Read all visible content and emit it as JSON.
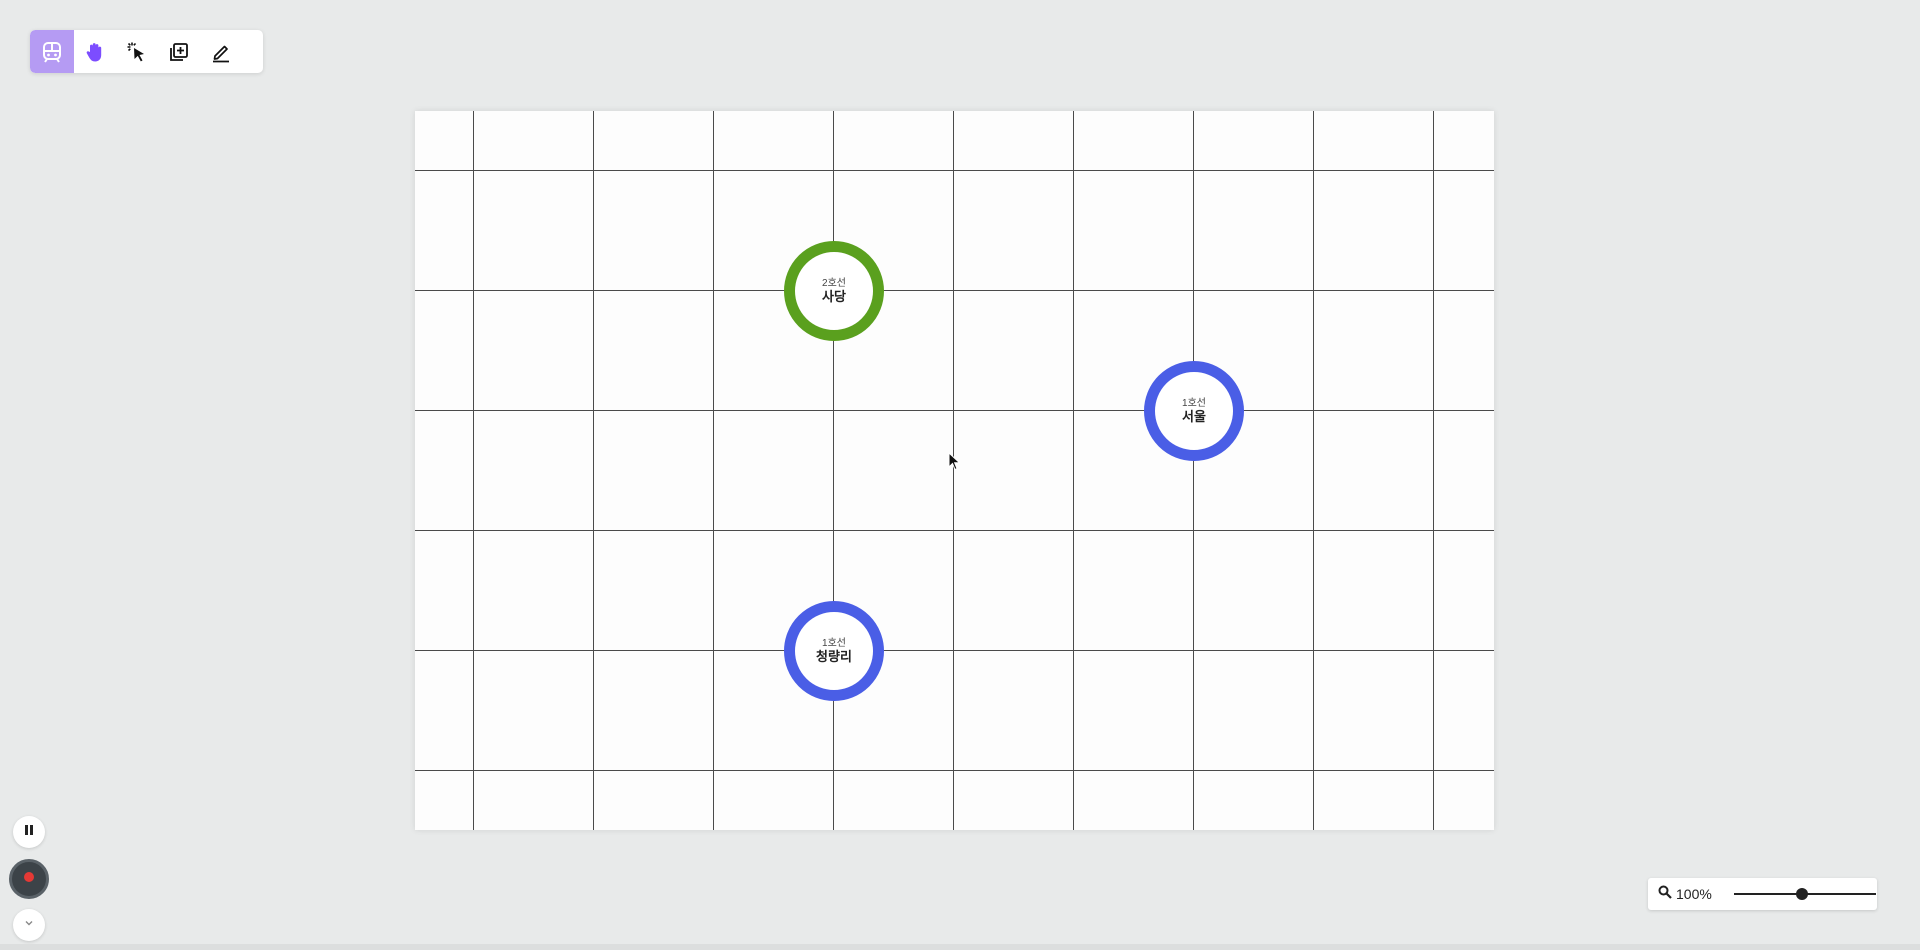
{
  "toolbar": {
    "tools": [
      {
        "icon": "train-icon",
        "active": true
      },
      {
        "icon": "hand-icon"
      },
      {
        "icon": "select-cursor-icon"
      },
      {
        "icon": "add-layer-icon"
      },
      {
        "icon": "pen-icon"
      }
    ],
    "active_color": "#b59bf3",
    "hand_color": "#7c4dff"
  },
  "stations": [
    {
      "line": "2호선",
      "name": "사당",
      "color": "#5aa01e"
    },
    {
      "line": "1호선",
      "name": "서울",
      "color": "#4a5ee6"
    },
    {
      "line": "1호선",
      "name": "청량리",
      "color": "#4a5ee6"
    }
  ],
  "controls": {
    "pause_icon": "pause-icon",
    "record_icon": "record-icon",
    "record_color": "#e53935",
    "expand_icon": "chevron-down-icon"
  },
  "zoom": {
    "label": "100%",
    "icon": "search-icon",
    "slider_value": 0.48
  }
}
